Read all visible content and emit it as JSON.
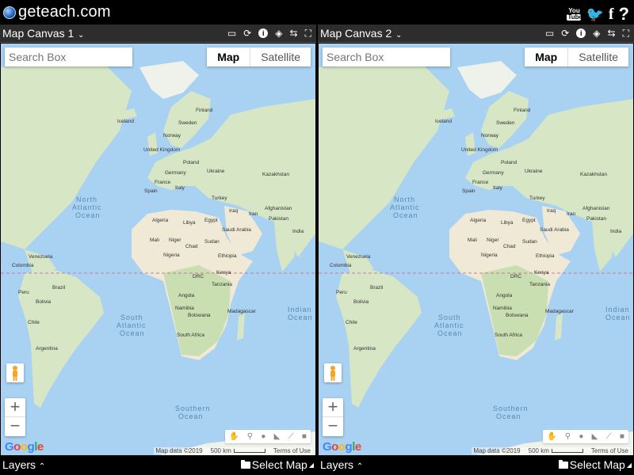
{
  "site": {
    "brand": "geteach.com"
  },
  "social": {
    "youtube_top": "You",
    "youtube_bottom": "Tube",
    "twitter": "🐦",
    "facebook": "f",
    "help": "?"
  },
  "panels": [
    {
      "title": "Map Canvas 1",
      "search_placeholder": "Search Box",
      "map_btn": "Map",
      "satellite_btn": "Satellite",
      "zoom_in": "+",
      "zoom_out": "−",
      "map_data": "Map data ©2019",
      "scale": "500 km",
      "terms": "Terms of Use",
      "layers": "Layers",
      "select_map": "Select Map"
    },
    {
      "title": "Map Canvas 2",
      "search_placeholder": "Search Box",
      "map_btn": "Map",
      "satellite_btn": "Satellite",
      "zoom_in": "+",
      "zoom_out": "−",
      "map_data": "Map data ©2019",
      "scale": "500 km",
      "terms": "Terms of Use",
      "layers": "Layers",
      "select_map": "Select Map"
    }
  ],
  "map_labels": {
    "countries": [
      "Finland",
      "Iceland",
      "Sweden",
      "Norway",
      "United Kingdom",
      "Poland",
      "Germany",
      "Ukraine",
      "France",
      "Kazakhstan",
      "Italy",
      "Spain",
      "Turkey",
      "Afghanistan",
      "Iraq",
      "Iran",
      "Pakistan",
      "Algeria",
      "Libya",
      "Egypt",
      "Saudi Arabia",
      "India",
      "Mali",
      "Niger",
      "Chad",
      "Sudan",
      "Nigeria",
      "Ethiopia",
      "Venezuela",
      "Colombia",
      "DRC",
      "Kenya",
      "Tanzania",
      "Brazil",
      "Peru",
      "Bolivia",
      "Angola",
      "Namibia",
      "Botswana",
      "Madagascar",
      "Chile",
      "South Africa",
      "Argentina"
    ],
    "oceans": {
      "north_atlantic": [
        "North",
        "Atlantic",
        "Ocean"
      ],
      "south_atlantic": [
        "South",
        "Atlantic",
        "Ocean"
      ],
      "indian": [
        "Indian",
        "Ocean"
      ],
      "southern": [
        "Southern",
        "Ocean"
      ]
    }
  },
  "colors": {
    "water": "#a8d1f2",
    "land": "#d7e6c5",
    "desert": "#efe9d6",
    "equator": "#c87a9a"
  }
}
